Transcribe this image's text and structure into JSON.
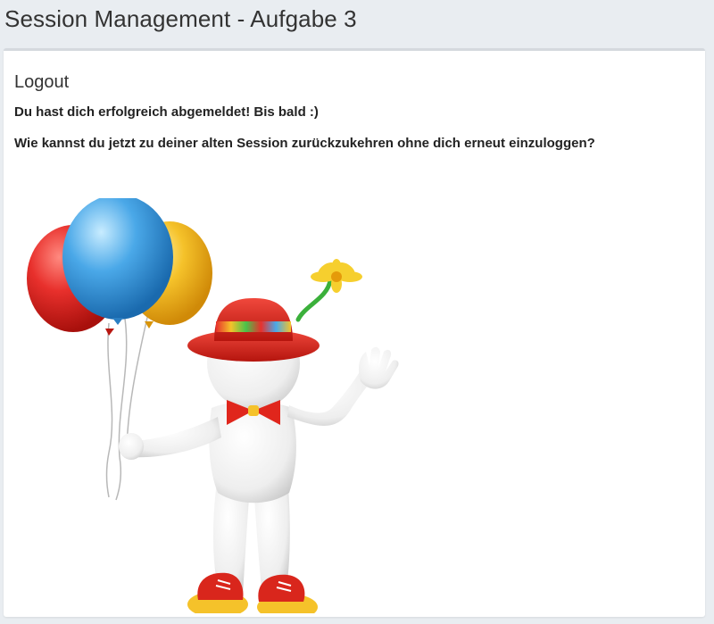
{
  "header": {
    "title": "Session Management - Aufgabe 3"
  },
  "panel": {
    "heading": "Logout",
    "message_1": "Du hast dich erfolgreich abgemeldet! Bis bald :)",
    "message_2": "Wie kannst du jetzt zu deiner alten Session zurückzukehren ohne dich erneut einzuloggen?"
  },
  "illustration": {
    "subject": "clown-figure-with-balloons",
    "balloon_colors": [
      "#e8302c",
      "#4aa8e8",
      "#f5c22a"
    ],
    "hat_color": "#d9261c",
    "flower_color": "#f6cf2e",
    "bowtie_color": "#e0261c",
    "shoe_colors": [
      "#d9261c",
      "#f5c22a"
    ]
  },
  "colors": {
    "page_background": "#e9edf1",
    "panel_background": "#ffffff",
    "text": "#333333"
  }
}
